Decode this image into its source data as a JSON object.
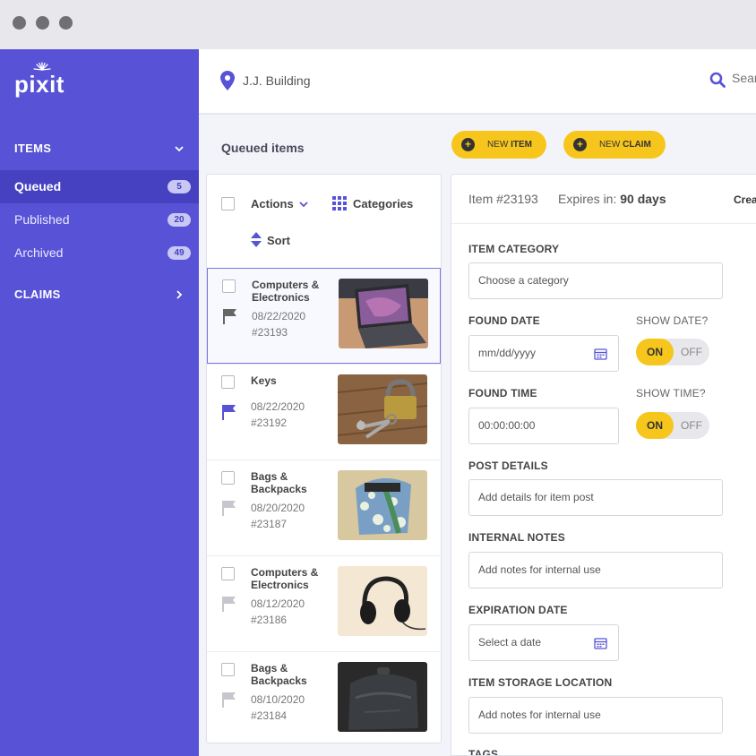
{
  "window": {
    "buttons": [
      "close",
      "minimize",
      "maximize"
    ]
  },
  "brand": {
    "name": "pixit",
    "color": "#5853d6",
    "accent": "#f7c61d"
  },
  "sidebar": {
    "items_header": "ITEMS",
    "nav": [
      {
        "label": "Queued",
        "count": "5",
        "active": true
      },
      {
        "label": "Published",
        "count": "20"
      },
      {
        "label": "Archived",
        "count": "49"
      }
    ],
    "claims_header": "CLAIMS"
  },
  "topbar": {
    "location": "J.J. Building",
    "search_placeholder": "Search"
  },
  "main": {
    "panel_title": "Queued items",
    "new_item": {
      "prefix": "NEW ",
      "bold": "ITEM"
    },
    "new_claim": {
      "prefix": "NEW ",
      "bold": "CLAIM"
    }
  },
  "list": {
    "actions_label": "Actions",
    "categories_label": "Categories",
    "sort_label": "Sort",
    "items": [
      {
        "category": "Computers & Electronics",
        "date": "08/22/2020",
        "id": "#23193",
        "flag": "gray",
        "image": "laptop"
      },
      {
        "category": "Keys",
        "date": "08/22/2020",
        "id": "#23192",
        "flag": "blue",
        "image": "keys"
      },
      {
        "category": "Bags & Backpacks",
        "date": "08/20/2020",
        "id": "#23187",
        "flag": "light",
        "image": "tote-bag"
      },
      {
        "category": "Computers & Electronics",
        "date": "08/12/2020",
        "id": "#23186",
        "flag": "light",
        "image": "headphones"
      },
      {
        "category": "Bags & Backpacks",
        "date": "08/10/2020",
        "id": "#23184",
        "flag": "light",
        "image": "backpack"
      }
    ]
  },
  "detail": {
    "item_id": "Item #23193",
    "expires_label": "Expires in:",
    "expires_value": "90 days",
    "create_label": "Crea",
    "category_label": "ITEM CATEGORY",
    "category_placeholder": "Choose a category",
    "found_date_label": "FOUND DATE",
    "found_date_placeholder": "mm/dd/yyyy",
    "show_date_label": "SHOW DATE?",
    "found_time_label": "FOUND TIME",
    "found_time_placeholder": "00:00:00:00",
    "show_time_label": "SHOW TIME?",
    "toggle_on": "ON",
    "toggle_off": "OFF",
    "post_details_label": "POST DETAILS",
    "post_details_placeholder": "Add details for item post",
    "internal_notes_label": "INTERNAL NOTES",
    "internal_notes_placeholder": "Add notes for internal use",
    "expiration_label": "EXPIRATION DATE",
    "expiration_placeholder": "Select a date",
    "storage_label": "ITEM STORAGE LOCATION",
    "storage_placeholder": "Add notes for internal use",
    "tags_label": "TAGS"
  }
}
